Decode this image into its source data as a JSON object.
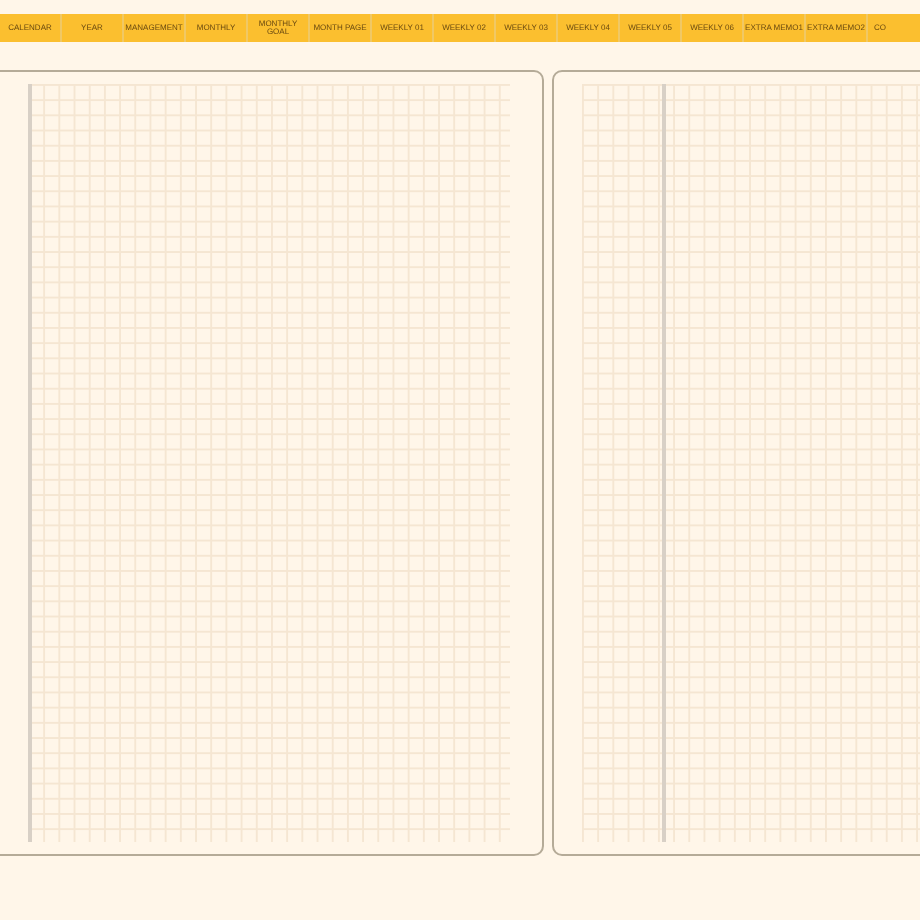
{
  "tabs": [
    {
      "label": "CALENDAR"
    },
    {
      "label": "YEAR"
    },
    {
      "label": "MANAGEMENT"
    },
    {
      "label": "MONTHLY"
    },
    {
      "label": "MONTHLY GOAL"
    },
    {
      "label": "MONTH PAGE"
    },
    {
      "label": "WEEKLY 01"
    },
    {
      "label": "WEEKLY 02"
    },
    {
      "label": "WEEKLY 03"
    },
    {
      "label": "WEEKLY 04"
    },
    {
      "label": "WEEKLY 05"
    },
    {
      "label": "WEEKLY 06"
    },
    {
      "label": "EXTRA MEMO1"
    },
    {
      "label": "EXTRA MEMO2"
    },
    {
      "label": "CO"
    }
  ]
}
